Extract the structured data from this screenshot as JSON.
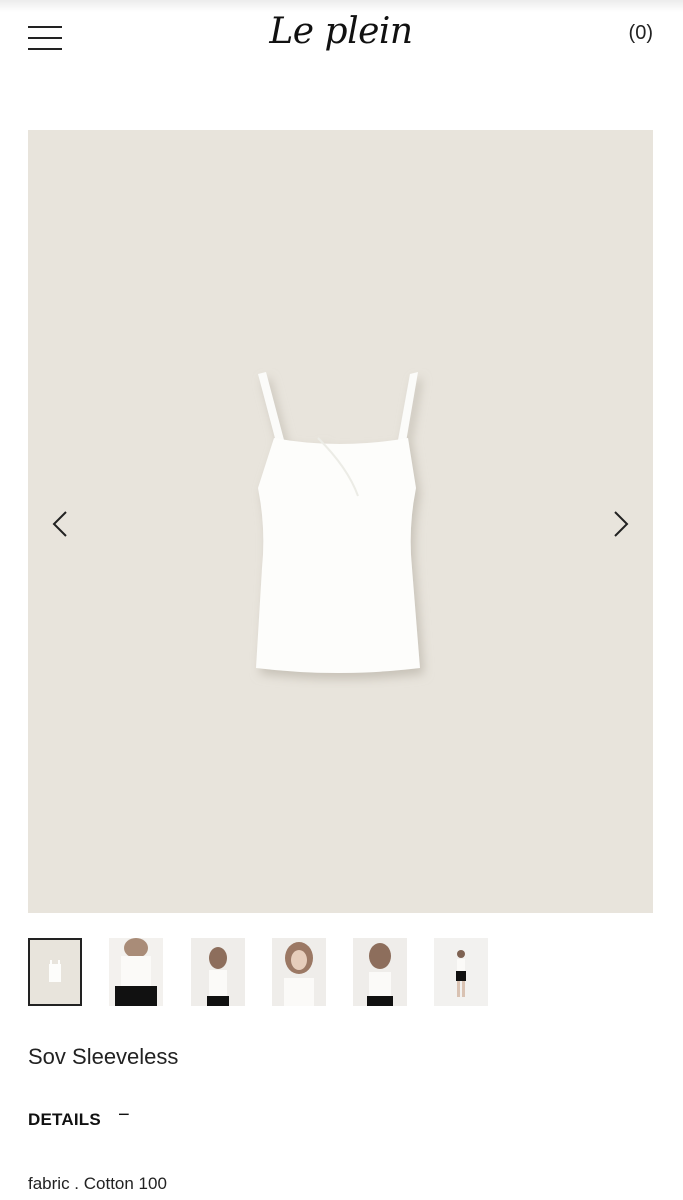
{
  "header": {
    "logo_text": "Le plein",
    "cart_label": "(0)",
    "menu_icon": "hamburger-menu-icon"
  },
  "gallery": {
    "background_color": "#e8e4dc",
    "prev_icon": "chevron-left-icon",
    "next_icon": "chevron-right-icon",
    "thumbnail_count": 6,
    "active_thumbnail": 1
  },
  "product": {
    "title": "Sov Sleeveless",
    "details_heading": "DETAILS",
    "details_toggle": "−",
    "fabric": "fabric . Cotton 100"
  }
}
